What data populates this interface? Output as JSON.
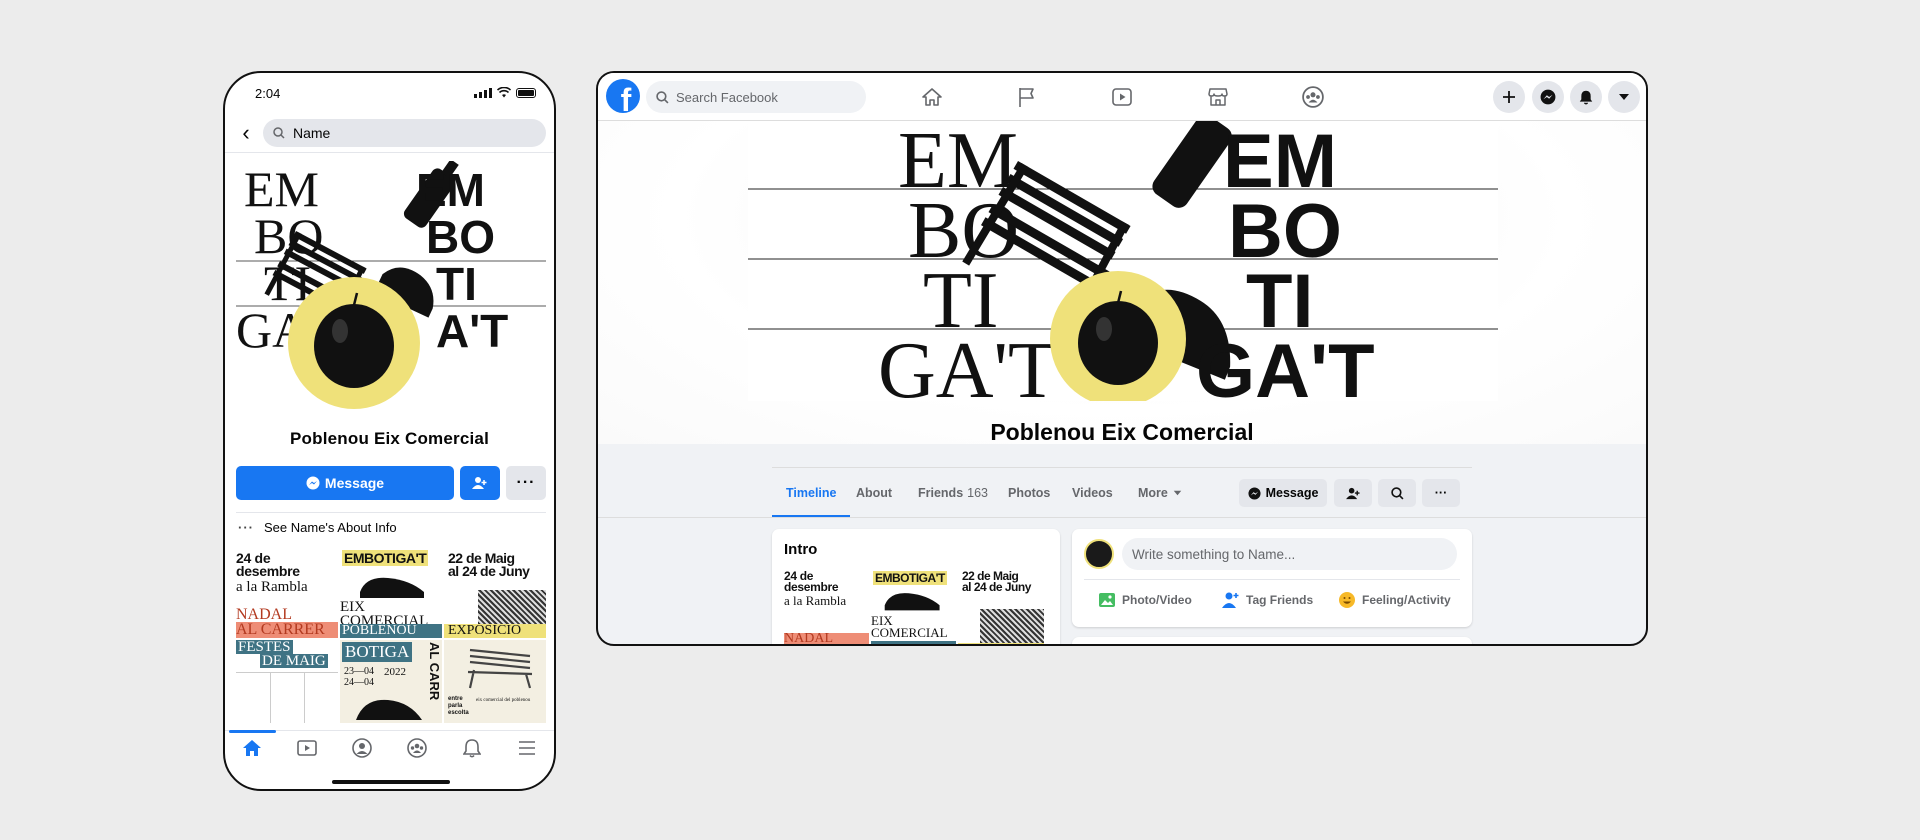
{
  "phone": {
    "status_time": "2:04",
    "search_value": "Name",
    "page_name": "Poblenou Eix Comercial",
    "message_label": "Message",
    "about_label": "See Name's About Info",
    "more_dots": "···"
  },
  "cover": {
    "left_lines": [
      "EM",
      "BO",
      "TI",
      "GA'T"
    ],
    "right_lines": [
      "EM",
      "BO",
      "TI",
      "A'T"
    ],
    "right_lines_desktop": [
      "EM",
      "BO",
      "TI",
      "GA'T"
    ],
    "accent_yellow": "#efe17a"
  },
  "posters": {
    "p1_line1": "24 de",
    "p1_line2": "desembre",
    "p1_line3": "a la Rambla",
    "p2_title": "EMBOTIGA'T",
    "p3_line1": "22 de Maig",
    "p3_line2": "al 24 de Juny",
    "p4_line1": "NADAL",
    "p4_line2": "AL CARRER",
    "p5_line1": "EIX",
    "p5_line2": "COMERCIAL",
    "p5_line3": "POBLENOU",
    "p6_title": "EXPOSICIO",
    "p7_line1": "FESTES",
    "p7_line2": "DE MAIG",
    "p8_title": "BOTIGA",
    "p8_dates1": "23—04",
    "p8_dates2": "24—04",
    "p8_year": "2022",
    "p9_vertical": "AL CARR",
    "p10_text1": "entre",
    "p10_text2": "parla",
    "p10_text3": "escolta",
    "p10_caption": "eix comercial del poblenou",
    "colors": {
      "salmon": "#ee8d76",
      "teal": "#3f7384",
      "yellow": "#efe17a",
      "cream": "#f3efe2"
    }
  },
  "desktop": {
    "search_placeholder": "Search Facebook",
    "logo_letter": "f",
    "page_name": "Poblenou Eix Comercial",
    "tabs": {
      "timeline": "Timeline",
      "about": "About",
      "friends": "Friends",
      "friends_count": "163",
      "photos": "Photos",
      "videos": "Videos",
      "more": "More"
    },
    "message_label": "Message",
    "more_dots": "···",
    "intro_title": "Intro",
    "composer_placeholder": "Write something to Name...",
    "actions": {
      "photo": "Photo/Video",
      "tag": "Tag Friends",
      "feeling": "Feeling/Activity"
    },
    "accent": "#1877f2"
  }
}
